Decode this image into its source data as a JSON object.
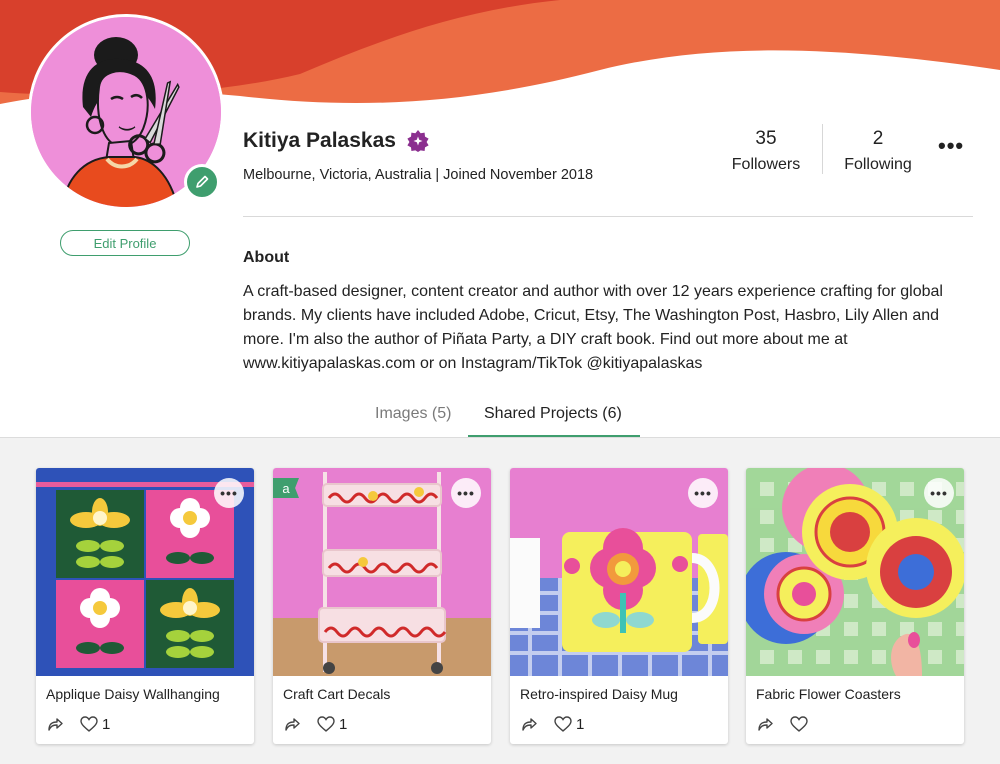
{
  "profile": {
    "name": "Kitiya Palaskas",
    "location_joined": "Melbourne, Victoria, Australia | Joined November 2018",
    "edit_profile_label": "Edit Profile",
    "followers_count": "35",
    "followers_label": "Followers",
    "following_count": "2",
    "following_label": "Following",
    "more_icon": "more-horizontal-icon"
  },
  "about": {
    "heading": "About",
    "text": "A craft-based designer, content creator and author with over 12 years experience crafting for global brands. My clients have included Adobe, Cricut, Etsy, The Washington Post, Hasbro, Lily Allen and more. I'm also the author of Piñata Party, a DIY craft book. Find out more about me at www.kitiyapalaskas.com or on Instagram/TikTok @kitiyapalaskas"
  },
  "tabs": [
    {
      "label": "Images (5)",
      "active": false
    },
    {
      "label": "Shared Projects (6)",
      "active": true
    }
  ],
  "projects": [
    {
      "title": "Applique Daisy Wallhanging",
      "likes": "1",
      "badge": ""
    },
    {
      "title": "Craft Cart Decals",
      "likes": "1",
      "badge": "a"
    },
    {
      "title": "Retro-inspired Daisy Mug",
      "likes": "1",
      "badge": ""
    },
    {
      "title": "Fabric Flower Coasters",
      "likes": "",
      "badge": ""
    }
  ],
  "colors": {
    "banner_red": "#d8402c",
    "banner_orange": "#ec6c44",
    "accent_green": "#3f9e6e",
    "verified_purple": "#8b2f8f",
    "avatar_pink": "#ee8fd9"
  }
}
